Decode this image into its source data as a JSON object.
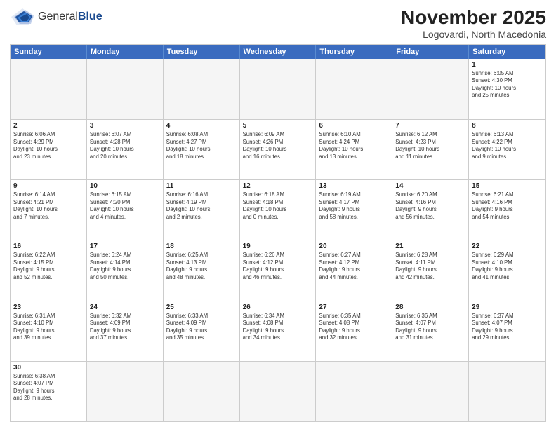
{
  "logo": {
    "text_regular": "General",
    "text_bold": "Blue"
  },
  "title": "November 2025",
  "subtitle": "Logovardi, North Macedonia",
  "header_days": [
    "Sunday",
    "Monday",
    "Tuesday",
    "Wednesday",
    "Thursday",
    "Friday",
    "Saturday"
  ],
  "weeks": [
    [
      {
        "day": "",
        "info": "",
        "empty": true
      },
      {
        "day": "",
        "info": "",
        "empty": true
      },
      {
        "day": "",
        "info": "",
        "empty": true
      },
      {
        "day": "",
        "info": "",
        "empty": true
      },
      {
        "day": "",
        "info": "",
        "empty": true
      },
      {
        "day": "",
        "info": "",
        "empty": true
      },
      {
        "day": "1",
        "info": "Sunrise: 6:05 AM\nSunset: 4:30 PM\nDaylight: 10 hours\nand 25 minutes.",
        "empty": false
      }
    ],
    [
      {
        "day": "2",
        "info": "Sunrise: 6:06 AM\nSunset: 4:29 PM\nDaylight: 10 hours\nand 23 minutes.",
        "empty": false
      },
      {
        "day": "3",
        "info": "Sunrise: 6:07 AM\nSunset: 4:28 PM\nDaylight: 10 hours\nand 20 minutes.",
        "empty": false
      },
      {
        "day": "4",
        "info": "Sunrise: 6:08 AM\nSunset: 4:27 PM\nDaylight: 10 hours\nand 18 minutes.",
        "empty": false
      },
      {
        "day": "5",
        "info": "Sunrise: 6:09 AM\nSunset: 4:26 PM\nDaylight: 10 hours\nand 16 minutes.",
        "empty": false
      },
      {
        "day": "6",
        "info": "Sunrise: 6:10 AM\nSunset: 4:24 PM\nDaylight: 10 hours\nand 13 minutes.",
        "empty": false
      },
      {
        "day": "7",
        "info": "Sunrise: 6:12 AM\nSunset: 4:23 PM\nDaylight: 10 hours\nand 11 minutes.",
        "empty": false
      },
      {
        "day": "8",
        "info": "Sunrise: 6:13 AM\nSunset: 4:22 PM\nDaylight: 10 hours\nand 9 minutes.",
        "empty": false
      }
    ],
    [
      {
        "day": "9",
        "info": "Sunrise: 6:14 AM\nSunset: 4:21 PM\nDaylight: 10 hours\nand 7 minutes.",
        "empty": false
      },
      {
        "day": "10",
        "info": "Sunrise: 6:15 AM\nSunset: 4:20 PM\nDaylight: 10 hours\nand 4 minutes.",
        "empty": false
      },
      {
        "day": "11",
        "info": "Sunrise: 6:16 AM\nSunset: 4:19 PM\nDaylight: 10 hours\nand 2 minutes.",
        "empty": false
      },
      {
        "day": "12",
        "info": "Sunrise: 6:18 AM\nSunset: 4:18 PM\nDaylight: 10 hours\nand 0 minutes.",
        "empty": false
      },
      {
        "day": "13",
        "info": "Sunrise: 6:19 AM\nSunset: 4:17 PM\nDaylight: 9 hours\nand 58 minutes.",
        "empty": false
      },
      {
        "day": "14",
        "info": "Sunrise: 6:20 AM\nSunset: 4:16 PM\nDaylight: 9 hours\nand 56 minutes.",
        "empty": false
      },
      {
        "day": "15",
        "info": "Sunrise: 6:21 AM\nSunset: 4:16 PM\nDaylight: 9 hours\nand 54 minutes.",
        "empty": false
      }
    ],
    [
      {
        "day": "16",
        "info": "Sunrise: 6:22 AM\nSunset: 4:15 PM\nDaylight: 9 hours\nand 52 minutes.",
        "empty": false
      },
      {
        "day": "17",
        "info": "Sunrise: 6:24 AM\nSunset: 4:14 PM\nDaylight: 9 hours\nand 50 minutes.",
        "empty": false
      },
      {
        "day": "18",
        "info": "Sunrise: 6:25 AM\nSunset: 4:13 PM\nDaylight: 9 hours\nand 48 minutes.",
        "empty": false
      },
      {
        "day": "19",
        "info": "Sunrise: 6:26 AM\nSunset: 4:12 PM\nDaylight: 9 hours\nand 46 minutes.",
        "empty": false
      },
      {
        "day": "20",
        "info": "Sunrise: 6:27 AM\nSunset: 4:12 PM\nDaylight: 9 hours\nand 44 minutes.",
        "empty": false
      },
      {
        "day": "21",
        "info": "Sunrise: 6:28 AM\nSunset: 4:11 PM\nDaylight: 9 hours\nand 42 minutes.",
        "empty": false
      },
      {
        "day": "22",
        "info": "Sunrise: 6:29 AM\nSunset: 4:10 PM\nDaylight: 9 hours\nand 41 minutes.",
        "empty": false
      }
    ],
    [
      {
        "day": "23",
        "info": "Sunrise: 6:31 AM\nSunset: 4:10 PM\nDaylight: 9 hours\nand 39 minutes.",
        "empty": false
      },
      {
        "day": "24",
        "info": "Sunrise: 6:32 AM\nSunset: 4:09 PM\nDaylight: 9 hours\nand 37 minutes.",
        "empty": false
      },
      {
        "day": "25",
        "info": "Sunrise: 6:33 AM\nSunset: 4:09 PM\nDaylight: 9 hours\nand 35 minutes.",
        "empty": false
      },
      {
        "day": "26",
        "info": "Sunrise: 6:34 AM\nSunset: 4:08 PM\nDaylight: 9 hours\nand 34 minutes.",
        "empty": false
      },
      {
        "day": "27",
        "info": "Sunrise: 6:35 AM\nSunset: 4:08 PM\nDaylight: 9 hours\nand 32 minutes.",
        "empty": false
      },
      {
        "day": "28",
        "info": "Sunrise: 6:36 AM\nSunset: 4:07 PM\nDaylight: 9 hours\nand 31 minutes.",
        "empty": false
      },
      {
        "day": "29",
        "info": "Sunrise: 6:37 AM\nSunset: 4:07 PM\nDaylight: 9 hours\nand 29 minutes.",
        "empty": false
      }
    ],
    [
      {
        "day": "30",
        "info": "Sunrise: 6:38 AM\nSunset: 4:07 PM\nDaylight: 9 hours\nand 28 minutes.",
        "empty": false
      },
      {
        "day": "",
        "info": "",
        "empty": true
      },
      {
        "day": "",
        "info": "",
        "empty": true
      },
      {
        "day": "",
        "info": "",
        "empty": true
      },
      {
        "day": "",
        "info": "",
        "empty": true
      },
      {
        "day": "",
        "info": "",
        "empty": true
      },
      {
        "day": "",
        "info": "",
        "empty": true
      }
    ]
  ]
}
